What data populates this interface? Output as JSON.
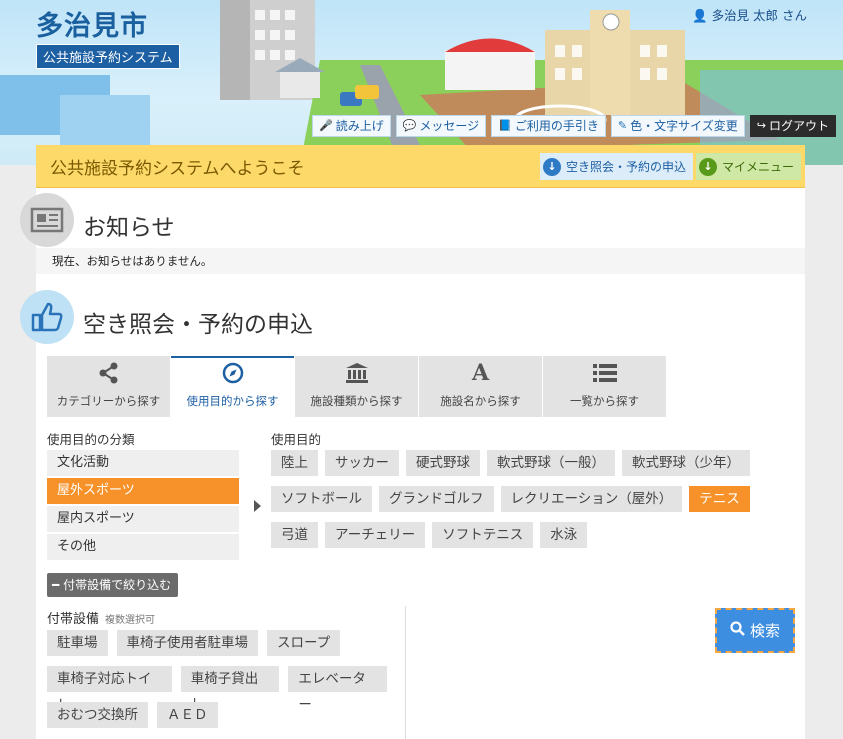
{
  "header": {
    "city_title": "多治見市",
    "system_badge": "公共施設予約システム",
    "user_name": "多治見 太郎 さん",
    "toolbar": [
      {
        "label": "読み上げ",
        "icon": "microphone-icon"
      },
      {
        "label": "メッセージ",
        "icon": "speech-bubble-icon"
      },
      {
        "label": "ご利用の手引き",
        "icon": "book-icon"
      },
      {
        "label": "色・文字サイズ変更",
        "icon": "brush-icon"
      },
      {
        "label": "ログアウト",
        "icon": "logout-icon"
      }
    ]
  },
  "welcome": {
    "text": "公共施設予約システムへようこそ",
    "availability_button": "空き照会・予約の申込",
    "mymenu_button": "マイメニュー"
  },
  "notice": {
    "title": "お知らせ",
    "message": "現在、お知らせはありません。"
  },
  "reservation": {
    "title": "空き照会・予約の申込",
    "tabs": [
      {
        "label": "カテゴリーから探す",
        "icon": "share-icon"
      },
      {
        "label": "使用目的から探す",
        "icon": "compass-icon"
      },
      {
        "label": "施設種類から探す",
        "icon": "institution-icon"
      },
      {
        "label": "施設名から探す",
        "icon": "font-a-icon"
      },
      {
        "label": "一覧から探す",
        "icon": "list-icon"
      }
    ],
    "active_tab": 1,
    "category_heading": "使用目的の分類",
    "categories": [
      "文化活動",
      "屋外スポーツ",
      "屋内スポーツ",
      "その他"
    ],
    "active_category": "屋外スポーツ",
    "purpose_heading": "使用目的",
    "purposes": [
      [
        "陸上",
        "サッカー",
        "硬式野球",
        "軟式野球（一般）",
        "軟式野球（少年）"
      ],
      [
        "ソフトボール",
        "グランドゴルフ",
        "レクリエーション（屋外）",
        "テニス"
      ],
      [
        "弓道",
        "アーチェリー",
        "ソフトテニス",
        "水泳"
      ]
    ],
    "active_purpose": "テニス",
    "filter_button": "付帯設備で絞り込む",
    "equipment_heading": "付帯設備",
    "equipment_note": "複数選択可",
    "equipment": [
      [
        "駐車場",
        "車椅子使用者駐車場",
        "スロープ"
      ],
      [
        "車椅子対応トイレ",
        "車椅子貸出し",
        "エレベーター"
      ],
      [
        "おむつ交換所",
        "ＡＥＤ"
      ]
    ],
    "search_button": "検索"
  },
  "colors": {
    "brand_blue": "#1d5fa3",
    "accent_orange": "#f7922a",
    "welcome_yellow": "#fdd96a",
    "search_blue": "#3d8de0"
  }
}
